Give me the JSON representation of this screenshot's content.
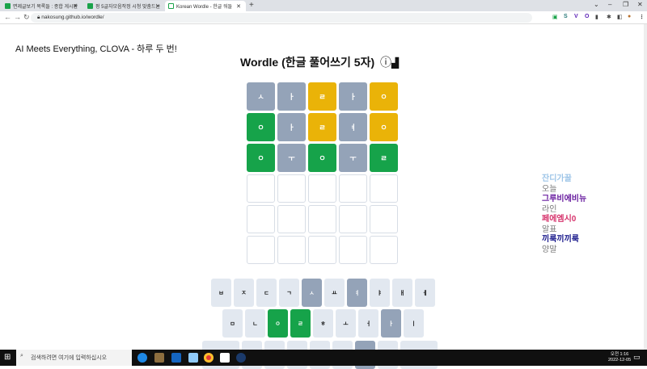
{
  "browser": {
    "tabs": [
      {
        "label": "면제글보기 목록들 : 종합 게시판"
      },
      {
        "label": "펑 5글자모음작정 시청 맞춤드는"
      },
      {
        "label": "Korean Wordle - 한글 워들"
      }
    ],
    "new_tab": "+",
    "url": "nakosung.github.io/wordle/"
  },
  "page": {
    "tagline": "AI Meets Everything, CLOVA - 하루 두 번!",
    "title": "Wordle (한글 풀어쓰기 5자)",
    "info_icon": "ⓘ",
    "stats_icon": "📊"
  },
  "board": [
    [
      {
        "l": "ㅅ",
        "s": "gray"
      },
      {
        "l": "ㅏ",
        "s": "gray"
      },
      {
        "l": "ㄹ",
        "s": "yellow"
      },
      {
        "l": "ㅏ",
        "s": "gray"
      },
      {
        "l": "ㅇ",
        "s": "yellow"
      }
    ],
    [
      {
        "l": "ㅇ",
        "s": "green"
      },
      {
        "l": "ㅏ",
        "s": "gray"
      },
      {
        "l": "ㄹ",
        "s": "yellow"
      },
      {
        "l": "ㅕ",
        "s": "gray"
      },
      {
        "l": "ㅇ",
        "s": "yellow"
      }
    ],
    [
      {
        "l": "ㅇ",
        "s": "green"
      },
      {
        "l": "ㅜ",
        "s": "gray"
      },
      {
        "l": "ㅇ",
        "s": "green"
      },
      {
        "l": "ㅜ",
        "s": "gray"
      },
      {
        "l": "ㄹ",
        "s": "green"
      }
    ],
    [
      {
        "l": "",
        "s": "empty"
      },
      {
        "l": "",
        "s": "empty"
      },
      {
        "l": "",
        "s": "empty"
      },
      {
        "l": "",
        "s": "empty"
      },
      {
        "l": "",
        "s": "empty"
      }
    ],
    [
      {
        "l": "",
        "s": "empty"
      },
      {
        "l": "",
        "s": "empty"
      },
      {
        "l": "",
        "s": "empty"
      },
      {
        "l": "",
        "s": "empty"
      },
      {
        "l": "",
        "s": "empty"
      }
    ],
    [
      {
        "l": "",
        "s": "empty"
      },
      {
        "l": "",
        "s": "empty"
      },
      {
        "l": "",
        "s": "empty"
      },
      {
        "l": "",
        "s": "empty"
      },
      {
        "l": "",
        "s": "empty"
      }
    ]
  ],
  "keyboard": [
    [
      {
        "l": "ㅂ"
      },
      {
        "l": "ㅈ"
      },
      {
        "l": "ㄷ"
      },
      {
        "l": "ㄱ"
      },
      {
        "l": "ㅅ",
        "s": "gray"
      },
      {
        "l": "ㅛ"
      },
      {
        "l": "ㅕ",
        "s": "gray"
      },
      {
        "l": "ㅑ"
      },
      {
        "l": "ㅐ"
      },
      {
        "l": "ㅔ"
      }
    ],
    [
      {
        "l": "ㅁ"
      },
      {
        "l": "ㄴ"
      },
      {
        "l": "ㅇ",
        "s": "green"
      },
      {
        "l": "ㄹ",
        "s": "green"
      },
      {
        "l": "ㅎ"
      },
      {
        "l": "ㅗ"
      },
      {
        "l": "ㅓ"
      },
      {
        "l": "ㅏ",
        "s": "gray"
      },
      {
        "l": "ㅣ"
      }
    ],
    [
      {
        "l": "",
        "w": 1
      },
      {
        "l": ""
      },
      {
        "l": ""
      },
      {
        "l": ""
      },
      {
        "l": ""
      },
      {
        "l": ""
      },
      {
        "l": "",
        "s": "gray"
      },
      {
        "l": ""
      },
      {
        "l": "",
        "w": 1
      }
    ]
  ],
  "sidebar": [
    {
      "title": "잔디가꿀",
      "sub": "오늘",
      "color": "#9ec5e8"
    },
    {
      "title": "그루비에비뉴",
      "sub": "라인",
      "color": "#6a1fa0"
    },
    {
      "title": "페에엠시0",
      "sub": "알표",
      "color": "#d6336c"
    },
    {
      "title": "끼룩끼끼룩",
      "sub": "양말",
      "color": "#1a1a8c"
    }
  ],
  "taskbar": {
    "search_placeholder": "검색하려면 여기에 입력하십시오",
    "time": "오전 1:16",
    "date": "2022-12-05"
  }
}
